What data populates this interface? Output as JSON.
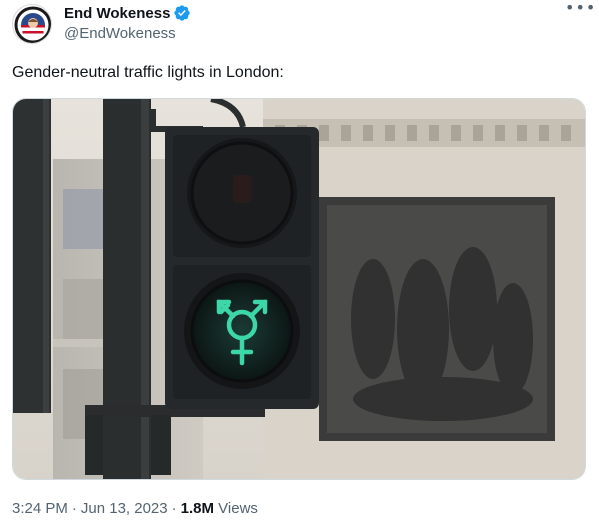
{
  "author": {
    "display_name": "End Wokeness",
    "handle": "@EndWokeness",
    "verified_color": "#1d9bf0"
  },
  "tweet": {
    "text": "Gender-neutral traffic lights in London:"
  },
  "media": {
    "description_icon": "transgender-symbol-icon",
    "signal_color": "#3dd6a8"
  },
  "meta": {
    "time": "3:24 PM",
    "date": "Jun 13, 2023",
    "views_count": "1.8M",
    "views_label": "Views"
  }
}
